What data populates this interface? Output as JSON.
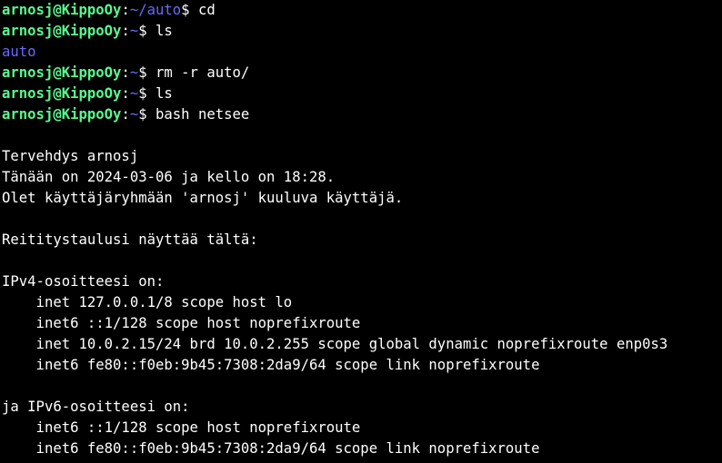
{
  "colors": {
    "background": "#000000",
    "user_host": "#5af78e",
    "path": "#6a6aff",
    "text": "#ffffff"
  },
  "prompt": {
    "user_host": "arnosj@KippoOy",
    "colon": ":",
    "dollar": "$ "
  },
  "lines": [
    {
      "type": "prompt",
      "path": "~/auto",
      "cmd": "cd"
    },
    {
      "type": "prompt",
      "path": "~",
      "cmd": "ls"
    },
    {
      "type": "dir",
      "text": "auto"
    },
    {
      "type": "prompt",
      "path": "~",
      "cmd": "rm -r auto/"
    },
    {
      "type": "prompt",
      "path": "~",
      "cmd": "ls"
    },
    {
      "type": "prompt",
      "path": "~",
      "cmd": "bash netsee"
    },
    {
      "type": "out",
      "text": ""
    },
    {
      "type": "out",
      "text": "Tervehdys arnosj"
    },
    {
      "type": "out",
      "text": "Tänään on 2024-03-06 ja kello on 18:28."
    },
    {
      "type": "out",
      "text": "Olet käyttäjäryhmään 'arnosj' kuuluva käyttäjä."
    },
    {
      "type": "out",
      "text": ""
    },
    {
      "type": "out",
      "text": "Reititystaulusi näyttää tältä:"
    },
    {
      "type": "out",
      "text": ""
    },
    {
      "type": "out",
      "text": "IPv4-osoitteesi on:"
    },
    {
      "type": "out",
      "text": "    inet 127.0.0.1/8 scope host lo"
    },
    {
      "type": "out",
      "text": "    inet6 ::1/128 scope host noprefixroute"
    },
    {
      "type": "out",
      "text": "    inet 10.0.2.15/24 brd 10.0.2.255 scope global dynamic noprefixroute enp0s3"
    },
    {
      "type": "out",
      "text": "    inet6 fe80::f0eb:9b45:7308:2da9/64 scope link noprefixroute"
    },
    {
      "type": "out",
      "text": ""
    },
    {
      "type": "out",
      "text": "ja IPv6-osoitteesi on:"
    },
    {
      "type": "out",
      "text": "    inet6 ::1/128 scope host noprefixroute"
    },
    {
      "type": "out",
      "text": "    inet6 fe80::f0eb:9b45:7308:2da9/64 scope link noprefixroute"
    }
  ]
}
